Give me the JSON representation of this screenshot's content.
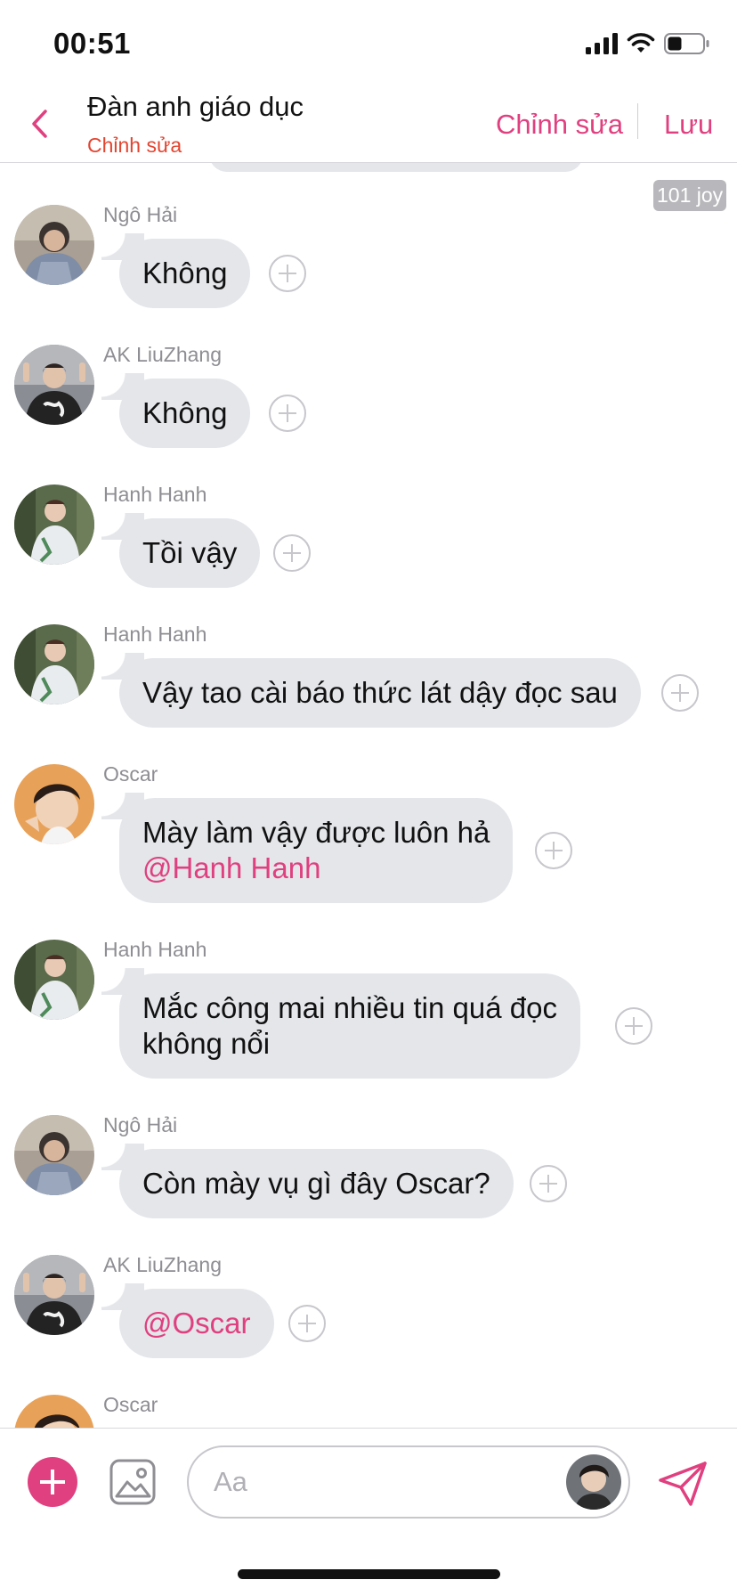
{
  "status_bar": {
    "time": "00:51"
  },
  "header": {
    "title": "Đàn anh giáo dục",
    "subtitle": "Chỉnh sửa",
    "edit_label": "Chỉnh sửa",
    "save_label": "Lưu"
  },
  "chat": {
    "badge": "101 joy",
    "messages": [
      {
        "sender": "Ngô Hải",
        "avatar": "person-hoodie-avatar",
        "parts": [
          {
            "text": "Không"
          }
        ]
      },
      {
        "sender": "AK LiuZhang",
        "avatar": "person-peace-sign-avatar",
        "parts": [
          {
            "text": "Không"
          }
        ]
      },
      {
        "sender": "Hanh Hanh",
        "avatar": "person-outdoor-avatar",
        "parts": [
          {
            "text": "Tồi vậy"
          }
        ]
      },
      {
        "sender": "Hanh Hanh",
        "avatar": "person-outdoor-avatar",
        "parts": [
          {
            "text": "Vậy tao cài báo thức lát dậy đọc sau"
          }
        ]
      },
      {
        "sender": "Oscar",
        "avatar": "person-closeup-avatar",
        "parts": [
          {
            "text": "Mày làm vậy được luôn hả"
          },
          {
            "text": "@Hanh Hanh",
            "mention": true
          }
        ]
      },
      {
        "sender": "Hanh Hanh",
        "avatar": "person-outdoor-avatar",
        "parts": [
          {
            "text": "Mắc công mai nhiều tin quá đọc"
          },
          {
            "text": "không nổi"
          }
        ]
      },
      {
        "sender": "Ngô Hải",
        "avatar": "person-hoodie-avatar",
        "parts": [
          {
            "text": "Còn mày vụ gì đây Oscar?"
          }
        ]
      },
      {
        "sender": "AK LiuZhang",
        "avatar": "person-peace-sign-avatar",
        "parts": [
          {
            "text": "@Oscar",
            "mention": true
          }
        ]
      },
      {
        "sender": "Oscar",
        "avatar": "person-closeup-avatar",
        "parts": []
      }
    ]
  },
  "input_bar": {
    "placeholder": "Aa",
    "add_icon": "plus-icon",
    "image_icon": "image-icon",
    "send_icon": "send-icon",
    "avatar": "user-avatar"
  },
  "colors": {
    "accent": "#e0407f",
    "subtitle_red": "#e3442f",
    "bubble": "#e4e6ea",
    "meta_gray": "#8e8e93"
  }
}
